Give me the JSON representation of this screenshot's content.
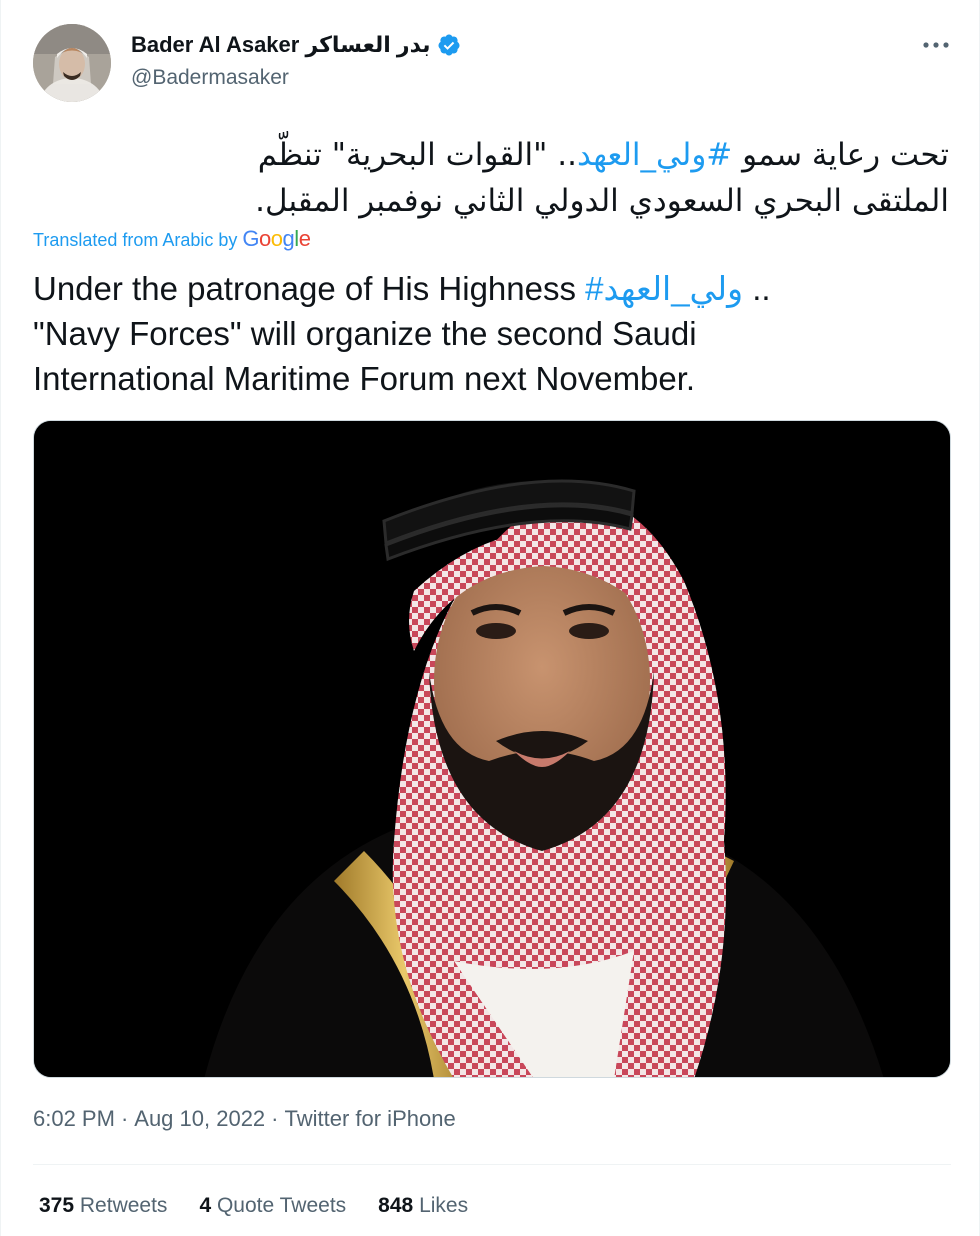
{
  "author": {
    "display_name": "Bader Al Asaker بدر العساكر",
    "handle": "@Badermasaker",
    "verified_icon": "verified-badge-icon",
    "avatar": "profile-avatar"
  },
  "tweet": {
    "arabic_line1_prefix": "تحت رعاية سمو ",
    "arabic_hashtag": "#ولي_العهد",
    "arabic_line1_suffix": ".. \"القوات البحرية\" تنظّم",
    "arabic_line2": "الملتقى البحري السعودي الدولي الثاني نوفمبر المقبل.",
    "translated_label": "Translated from Arabic by",
    "google_letters": [
      "G",
      "o",
      "o",
      "g",
      "l",
      "e"
    ],
    "english_prefix": "Under the patronage of His Highness ",
    "english_hashtag": "#ولي_العهد",
    "english_suffix": " ..",
    "english_line2": "\"Navy Forces\" will organize the second Saudi",
    "english_line3": "International Maritime Forum next November."
  },
  "meta": {
    "time": "6:02 PM",
    "sep1": "·",
    "date": "Aug 10, 2022",
    "sep2": "·",
    "source": "Twitter for iPhone"
  },
  "stats": {
    "retweets_count": "375",
    "retweets_label": "Retweets",
    "quotes_count": "4",
    "quotes_label": "Quote Tweets",
    "likes_count": "848",
    "likes_label": "Likes"
  },
  "colors": {
    "accent": "#1d9bf0",
    "text": "#0f1419",
    "secondary": "#536471"
  }
}
